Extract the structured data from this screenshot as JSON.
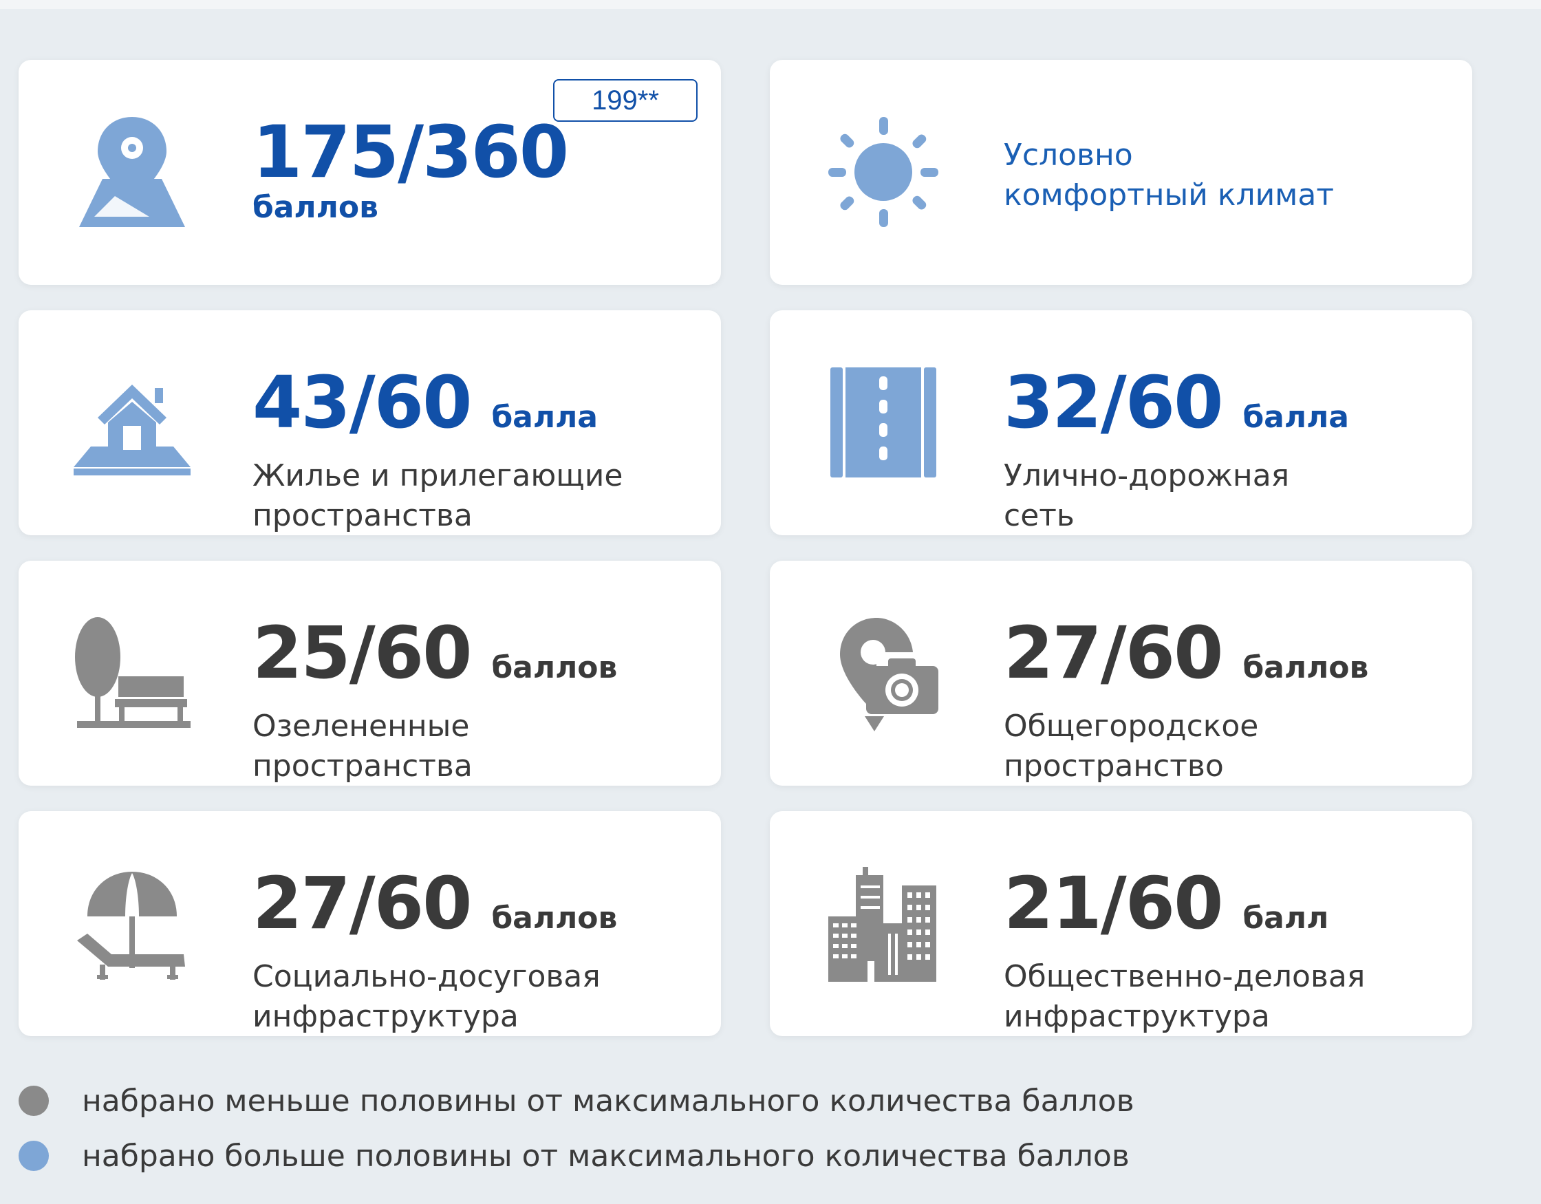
{
  "badge": "199**",
  "cards": [
    {
      "icon": "map-pin-icon",
      "score": "175/360",
      "unit": "баллов",
      "desc1": "",
      "desc2": ""
    },
    {
      "icon": "sun-icon",
      "score": "",
      "unit": "",
      "desc1": "Условно",
      "desc2": "комфортный климат"
    },
    {
      "icon": "house-icon",
      "score": "43/60",
      "unit": "балла",
      "desc1": "Жилье и прилегающие",
      "desc2": "пространства"
    },
    {
      "icon": "road-icon",
      "score": "32/60",
      "unit": "балла",
      "desc1": "Улично-дорожная",
      "desc2": "сеть"
    },
    {
      "icon": "park-bench-icon",
      "score": "25/60",
      "unit": "баллов",
      "desc1": "Озелененные",
      "desc2": "пространства"
    },
    {
      "icon": "camera-pin-icon",
      "score": "27/60",
      "unit": "баллов",
      "desc1": "Общегородское",
      "desc2": "пространство"
    },
    {
      "icon": "beach-umbrella-icon",
      "score": "27/60",
      "unit": "баллов",
      "desc1": "Социально-досуговая",
      "desc2": "инфраструктура"
    },
    {
      "icon": "skyscrapers-icon",
      "score": "21/60",
      "unit": "балл",
      "desc1": "Общественно-деловая",
      "desc2": "инфраструктура"
    }
  ],
  "legend": [
    {
      "text": "набрано меньше половины от максимального количества баллов",
      "color": "#8a8a8a"
    },
    {
      "text": "набрано больше половины от максимального количества баллов",
      "color": "#7ea6d6"
    }
  ],
  "colors": {
    "blue_text": "#1150a8",
    "blue_icon": "#7ea6d6",
    "gray_icon": "#8a8a8a",
    "dark_text": "#3a3a3a"
  }
}
